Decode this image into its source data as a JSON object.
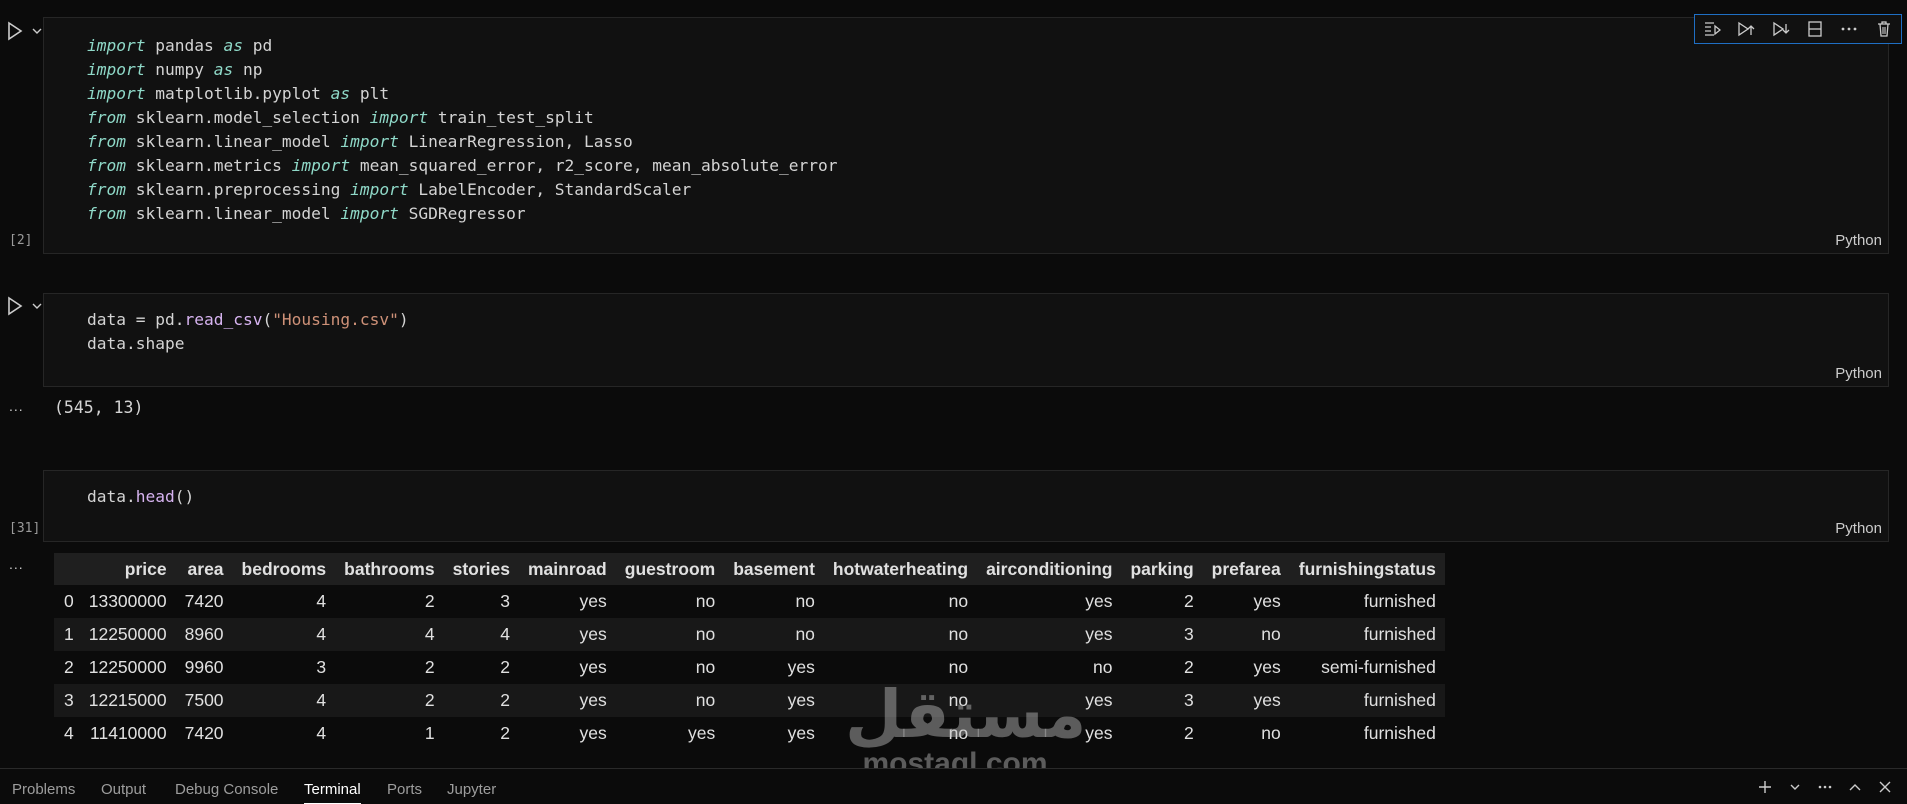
{
  "cells": [
    {
      "execution_count": "[2]",
      "language": "Python",
      "code_lines": [
        [
          {
            "t": "import",
            "c": "kw"
          },
          {
            "t": " pandas "
          },
          {
            "t": "as",
            "c": "kw"
          },
          {
            "t": " pd"
          }
        ],
        [
          {
            "t": "import",
            "c": "kw"
          },
          {
            "t": " numpy "
          },
          {
            "t": "as",
            "c": "kw"
          },
          {
            "t": " np"
          }
        ],
        [
          {
            "t": "import",
            "c": "kw"
          },
          {
            "t": " matplotlib.pyplot "
          },
          {
            "t": "as",
            "c": "kw"
          },
          {
            "t": " plt"
          }
        ],
        [
          {
            "t": "from",
            "c": "kw"
          },
          {
            "t": " sklearn.model_selection "
          },
          {
            "t": "import",
            "c": "kw"
          },
          {
            "t": " train_test_split"
          }
        ],
        [
          {
            "t": "from",
            "c": "kw"
          },
          {
            "t": " sklearn.linear_model "
          },
          {
            "t": "import",
            "c": "kw"
          },
          {
            "t": " LinearRegression, Lasso"
          }
        ],
        [
          {
            "t": "from",
            "c": "kw"
          },
          {
            "t": " sklearn.metrics "
          },
          {
            "t": "import",
            "c": "kw"
          },
          {
            "t": " mean_squared_error, r2_score, mean_absolute_error"
          }
        ],
        [
          {
            "t": "from",
            "c": "kw"
          },
          {
            "t": " sklearn.preprocessing "
          },
          {
            "t": "import",
            "c": "kw"
          },
          {
            "t": " LabelEncoder, StandardScaler"
          }
        ],
        [
          {
            "t": "from",
            "c": "kw"
          },
          {
            "t": " sklearn.linear_model "
          },
          {
            "t": "import",
            "c": "kw"
          },
          {
            "t": " SGDRegressor"
          }
        ]
      ]
    },
    {
      "execution_count": "",
      "language": "Python",
      "code_lines": [
        [
          {
            "t": "data = pd."
          },
          {
            "t": "read_csv",
            "c": "fn"
          },
          {
            "t": "("
          },
          {
            "t": "\"Housing.csv\"",
            "c": "str"
          },
          {
            "t": ")"
          }
        ],
        [
          {
            "t": "data.shape"
          }
        ]
      ],
      "output": "(545, 13)"
    },
    {
      "execution_count": "[31]",
      "language": "Python",
      "code_lines": [
        [
          {
            "t": "data."
          },
          {
            "t": "head",
            "c": "fn"
          },
          {
            "t": "()"
          }
        ]
      ]
    }
  ],
  "output_menu": "...",
  "dataframe": {
    "columns": [
      "",
      "price",
      "area",
      "bedrooms",
      "bathrooms",
      "stories",
      "mainroad",
      "guestroom",
      "basement",
      "hotwaterheating",
      "airconditioning",
      "parking",
      "prefarea",
      "furnishingstatus"
    ],
    "rows": [
      [
        "0",
        "13300000",
        "7420",
        "4",
        "2",
        "3",
        "yes",
        "no",
        "no",
        "no",
        "yes",
        "2",
        "yes",
        "furnished"
      ],
      [
        "1",
        "12250000",
        "8960",
        "4",
        "4",
        "4",
        "yes",
        "no",
        "no",
        "no",
        "yes",
        "3",
        "no",
        "furnished"
      ],
      [
        "2",
        "12250000",
        "9960",
        "3",
        "2",
        "2",
        "yes",
        "no",
        "yes",
        "no",
        "no",
        "2",
        "yes",
        "semi-furnished"
      ],
      [
        "3",
        "12215000",
        "7500",
        "4",
        "2",
        "2",
        "yes",
        "no",
        "yes",
        "no",
        "yes",
        "3",
        "yes",
        "furnished"
      ],
      [
        "4",
        "11410000",
        "7420",
        "4",
        "1",
        "2",
        "yes",
        "yes",
        "yes",
        "no",
        "yes",
        "2",
        "no",
        "furnished"
      ]
    ]
  },
  "panel": {
    "tabs": [
      "Problems",
      "Output",
      "Debug Console",
      "Terminal",
      "Ports",
      "Jupyter"
    ],
    "active_tab": "Terminal"
  },
  "watermark": {
    "arabic": "مستقل",
    "latin": "mostaql.com"
  },
  "colors": {
    "background": "#0b0b0b",
    "cell": "#111111",
    "keyword": "#8fd9c8",
    "function": "#d6b3f0",
    "string": "#ce9178",
    "toolbar_border": "#1f6fc4"
  }
}
